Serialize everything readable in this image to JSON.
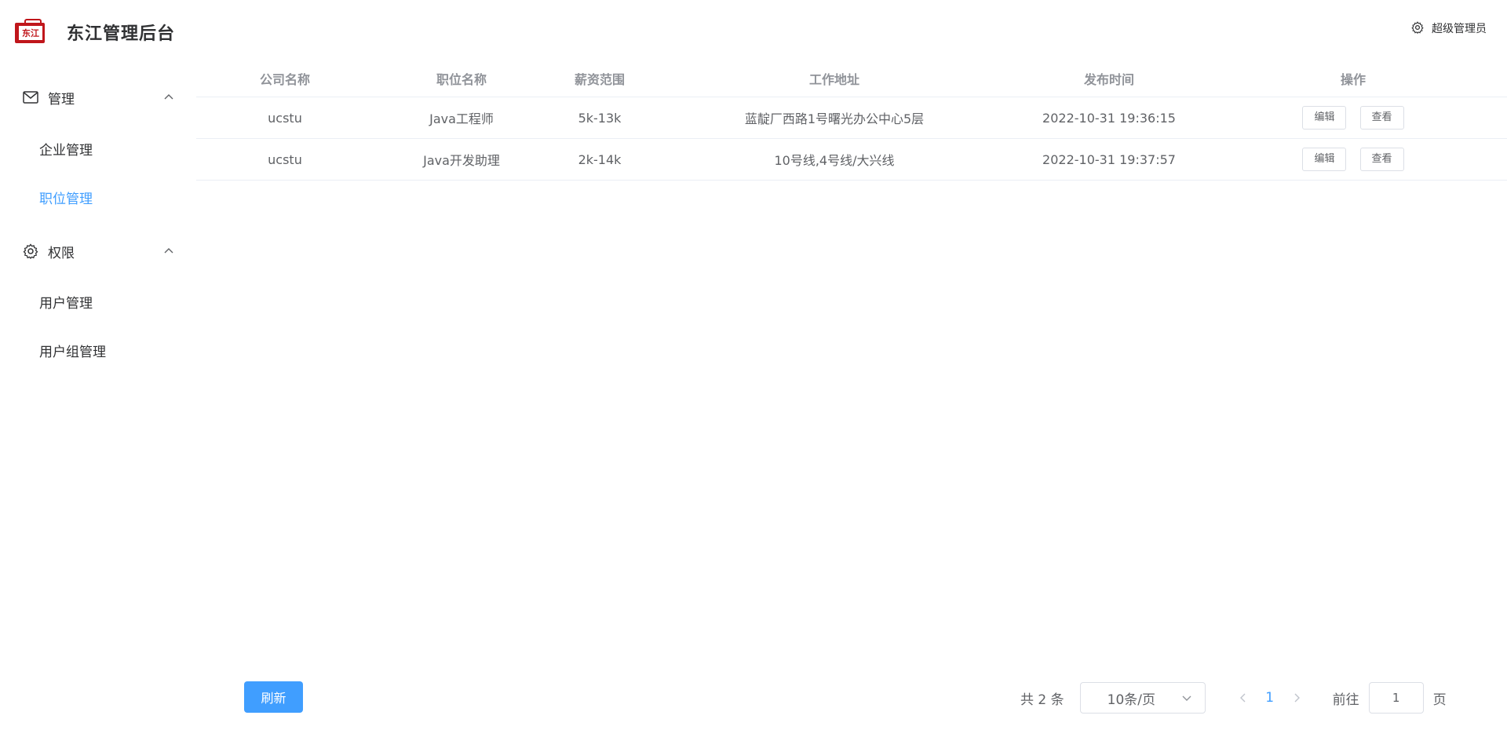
{
  "brand": {
    "logo_text": "东江",
    "title": "东江管理后台"
  },
  "user": {
    "name": "超级管理员",
    "icon": "gear-icon"
  },
  "sidebar": {
    "groups": [
      {
        "label": "管理",
        "icon": "mail-icon",
        "items": [
          {
            "label": "企业管理"
          },
          {
            "label": "职位管理",
            "active": true
          }
        ]
      },
      {
        "label": "权限",
        "icon": "gear-icon",
        "items": [
          {
            "label": "用户管理"
          },
          {
            "label": "用户组管理"
          }
        ]
      }
    ]
  },
  "table": {
    "columns": [
      "公司名称",
      "职位名称",
      "薪资范围",
      "工作地址",
      "发布时间",
      "操作"
    ],
    "rows": [
      {
        "company": "ucstu",
        "position": "Java工程师",
        "salary": "5k-13k",
        "address": "蓝靛厂西路1号曙光办公中心5层",
        "time": "2022-10-31 19:36:15",
        "edit": "编辑",
        "view": "查看"
      },
      {
        "company": "ucstu",
        "position": "Java开发助理",
        "salary": "2k-14k",
        "address": "10号线,4号线/大兴线",
        "time": "2022-10-31 19:37:57",
        "edit": "编辑",
        "view": "查看"
      }
    ]
  },
  "footer": {
    "refresh_label": "刷新",
    "total": "共 2 条",
    "page_size": "10条/页",
    "current_page": "1",
    "goto_label": "前往",
    "goto_value": "1",
    "page_suffix": "页"
  },
  "colors": {
    "accent": "#409eff",
    "brand_red": "#c0161b"
  }
}
